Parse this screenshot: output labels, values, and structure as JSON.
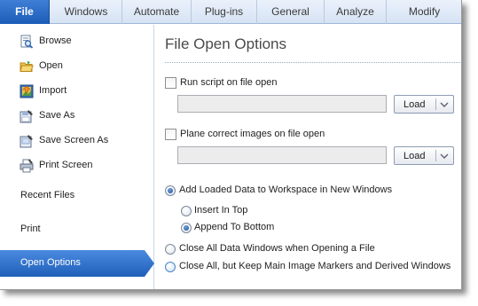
{
  "ribbon": {
    "tabs": [
      {
        "label": "File"
      },
      {
        "label": "Windows"
      },
      {
        "label": "Automate"
      },
      {
        "label": "Plug-ins"
      },
      {
        "label": "General"
      },
      {
        "label": "Analyze"
      },
      {
        "label": "Modify"
      }
    ],
    "active_tab": "File",
    "accent_color": "#2a68c2"
  },
  "sidebar": {
    "items": [
      {
        "label": "Browse",
        "icon": "browse-icon"
      },
      {
        "label": "Open",
        "icon": "open-folder-icon"
      },
      {
        "label": "Import",
        "icon": "import-icon"
      },
      {
        "label": "Save As",
        "icon": "save-as-icon"
      },
      {
        "label": "Save Screen As",
        "icon": "save-screen-icon"
      },
      {
        "label": "Print Screen",
        "icon": "print-screen-icon"
      }
    ],
    "sections": [
      "Recent Files",
      "Print",
      "Open Options"
    ],
    "selected": "Open Options",
    "selected_color": "#2a6fc9"
  },
  "main": {
    "title": "File Open Options",
    "run_script": {
      "label": "Run script on file open",
      "checked": false,
      "path": "",
      "button": "Load"
    },
    "plane_correct": {
      "label": "Plane correct images on file open",
      "checked": false,
      "path": "",
      "button": "Load"
    },
    "options": [
      {
        "label": "Add Loaded Data to Workspace in New Windows",
        "checked": true
      },
      {
        "label": "Insert In Top",
        "checked": false
      },
      {
        "label": "Append To Bottom",
        "checked": true
      },
      {
        "label": "Close All Data Windows when Opening a File",
        "checked": false
      },
      {
        "label": "Close All, but Keep Main Image Markers and Derived Windows",
        "checked": false
      }
    ]
  }
}
